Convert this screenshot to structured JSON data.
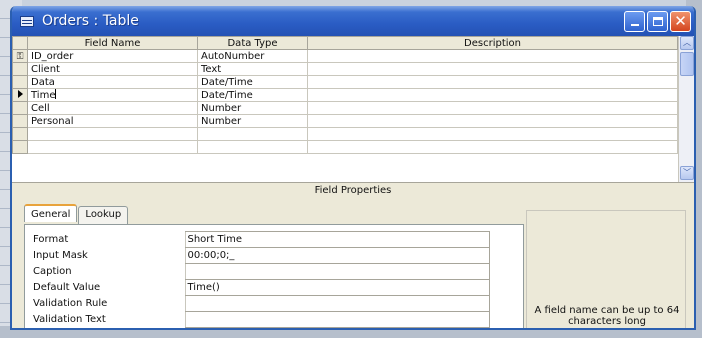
{
  "window": {
    "title": "Orders : Table"
  },
  "grid": {
    "headers": {
      "field_name": "Field Name",
      "data_type": "Data Type",
      "description": "Description"
    },
    "rows": [
      {
        "marker": "key",
        "name": "ID_order",
        "type": "AutoNumber",
        "description": ""
      },
      {
        "marker": "",
        "name": "Client",
        "type": "Text",
        "description": ""
      },
      {
        "marker": "",
        "name": "Data",
        "type": "Date/Time",
        "description": ""
      },
      {
        "marker": "current",
        "name": "Time",
        "type": "Date/Time",
        "description": ""
      },
      {
        "marker": "",
        "name": "Cell",
        "type": "Number",
        "description": ""
      },
      {
        "marker": "",
        "name": "Personal",
        "type": "Number",
        "description": ""
      },
      {
        "marker": "",
        "name": "",
        "type": "",
        "description": ""
      },
      {
        "marker": "",
        "name": "",
        "type": "",
        "description": ""
      }
    ]
  },
  "field_properties": {
    "header": "Field Properties",
    "tabs": {
      "general": "General",
      "lookup": "Lookup"
    },
    "properties": [
      {
        "name": "Format",
        "value": "Short Time"
      },
      {
        "name": "Input Mask",
        "value": "00:00;0;_"
      },
      {
        "name": "Caption",
        "value": ""
      },
      {
        "name": "Default Value",
        "value": "Time()"
      },
      {
        "name": "Validation Rule",
        "value": ""
      },
      {
        "name": "Validation Text",
        "value": ""
      }
    ],
    "help_text": "A field name can be up to 64 characters long"
  }
}
